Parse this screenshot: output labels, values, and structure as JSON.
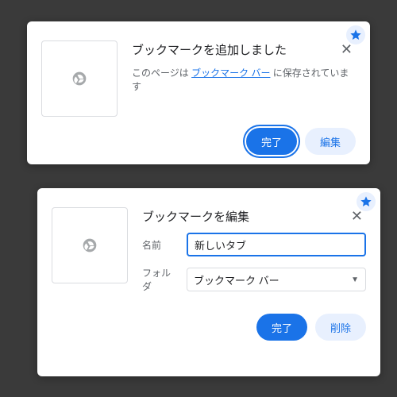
{
  "panel1": {
    "title": "ブックマークを追加しました",
    "subtext_before": "このページは ",
    "link": "ブックマーク バー",
    "subtext_after": " に保存されています",
    "done": "完了",
    "edit": "編集"
  },
  "panel2": {
    "title": "ブックマークを編集",
    "name_label": "名前",
    "name_value": "新しいタブ",
    "folder_label": "フォルダ",
    "folder_value": "ブックマーク バー",
    "done": "完了",
    "delete": "削除"
  }
}
